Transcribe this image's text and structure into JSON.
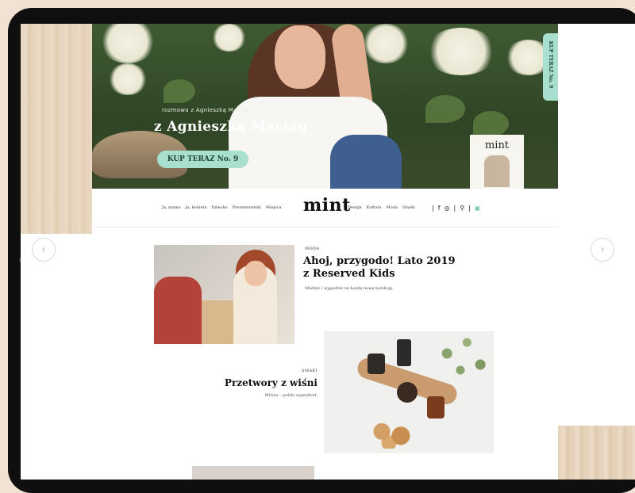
{
  "hero": {
    "small_text": "rozmowa z Agnieszką Maciąg",
    "title": "z Agnieszką Maciąg",
    "cta_label": "KUP TERAZ No. 9",
    "side_tab_label": "KUP TERAZ No. 9",
    "magazine_title": "mint"
  },
  "nav": {
    "left_items": [
      "Ja, mama",
      "Ja, kobieta",
      "Dziecko",
      "Prezentowniki",
      "Miejsca"
    ],
    "logo": "mint",
    "right_items": [
      "Design",
      "Kultura",
      "Moda",
      "Smaki"
    ]
  },
  "articles": [
    {
      "category": "MODA",
      "title": "Ahoj, przygodo! Lato 2019 z Reserved Kids",
      "lead": "Modnie i wygodnie na każdą nową kolekcję."
    },
    {
      "category": "SMAKI",
      "title": "Przetwory z wiśni",
      "lead": "Wiśnia – polski superfood."
    }
  ],
  "icons": {
    "facebook": "facebook-icon",
    "instagram": "instagram-icon",
    "search": "search-icon",
    "cart": "cart-icon",
    "prev": "chevron-left-icon",
    "next": "chevron-right-icon"
  }
}
